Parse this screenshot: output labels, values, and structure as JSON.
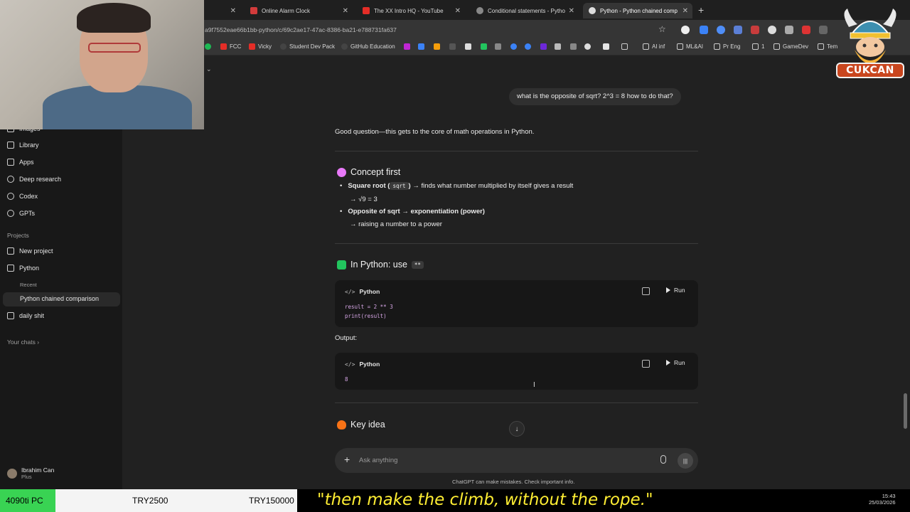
{
  "colors": {
    "accent_green": "#39d353",
    "quote_yellow": "#ffee33",
    "bg": "#212121",
    "sidebar": "#181818"
  },
  "browser": {
    "tabs": [
      {
        "title": "",
        "icon": "blank-tab-icon"
      },
      {
        "title": "Online Alarm Clock",
        "icon": "k-icon"
      },
      {
        "title": "The XX Intro HQ - YouTube",
        "icon": "youtube-icon"
      },
      {
        "title": "Conditional statements - Pytho",
        "icon": "globe-icon"
      },
      {
        "title": "Python - Python chained comp",
        "icon": "chatgpt-icon",
        "active": true
      }
    ],
    "new_tab": "+",
    "url": "a9f7552eae66b1bb-python/c/69c2ae17-47ac-8386-ba21-e788731fa637",
    "bookmarks": [
      "FCC",
      "Vicky",
      "Student Dev Pack",
      "GitHub Education",
      "AI inf",
      "ML&AI",
      "Pr Eng",
      "1",
      "GameDev",
      "Tem"
    ]
  },
  "sidebar": {
    "items": [
      {
        "label": "Images",
        "icon": "images-icon"
      },
      {
        "label": "Library",
        "icon": "library-icon"
      },
      {
        "label": "Apps",
        "icon": "apps-icon"
      },
      {
        "label": "Deep research",
        "icon": "deep-research-icon"
      },
      {
        "label": "Codex",
        "icon": "codex-icon"
      },
      {
        "label": "GPTs",
        "icon": "gpts-icon"
      }
    ],
    "projects_label": "Projects",
    "projects": [
      {
        "label": "New project",
        "icon": "new-folder-icon"
      },
      {
        "label": "Python",
        "icon": "folder-icon"
      }
    ],
    "recent_label": "Recent",
    "recent_item": "Python chained comparison",
    "daily": "daily shit",
    "your_chats": "Your chats ›",
    "user": {
      "name": "Ibrahim Can",
      "plan": "Plus"
    }
  },
  "chat": {
    "user_message": "what is the opposite of sqrt? 2^3 = 8 how to do that?",
    "intro": "Good question—this gets to the core of math operations in Python.",
    "section1_title": "Concept first",
    "bullet1_bold": "Square root (",
    "bullet1_code": "sqrt",
    "bullet1_bold_end": ")",
    "bullet1_rest": "→ finds what number multiplied by itself gives a result",
    "bullet1_sub": "→ √9 = 3",
    "bullet2_bold": "Opposite of sqrt → exponentiation (power)",
    "bullet2_sub": "→ raising a number to a power",
    "section2_title": "In Python: use",
    "section2_code": "**",
    "code1": {
      "lang": "Python",
      "run": "Run",
      "lines": [
        "result = 2 ** 3",
        "print(result)"
      ]
    },
    "output_label": "Output:",
    "code2": {
      "lang": "Python",
      "run": "Run",
      "lines": [
        "8"
      ]
    },
    "section3_title": "Key idea"
  },
  "composer": {
    "placeholder": "Ask anything",
    "disclaimer": "ChatGPT can make mistakes. Check important info."
  },
  "logo": {
    "text": "CUKCAN"
  },
  "overlay": {
    "pc_label": "4090ti PC",
    "amount1": "TRY2500",
    "amount2": "TRY150000",
    "quote": "\"then make the climb, without the rope.\"",
    "time": "15:43",
    "date": "25/03/2026"
  }
}
